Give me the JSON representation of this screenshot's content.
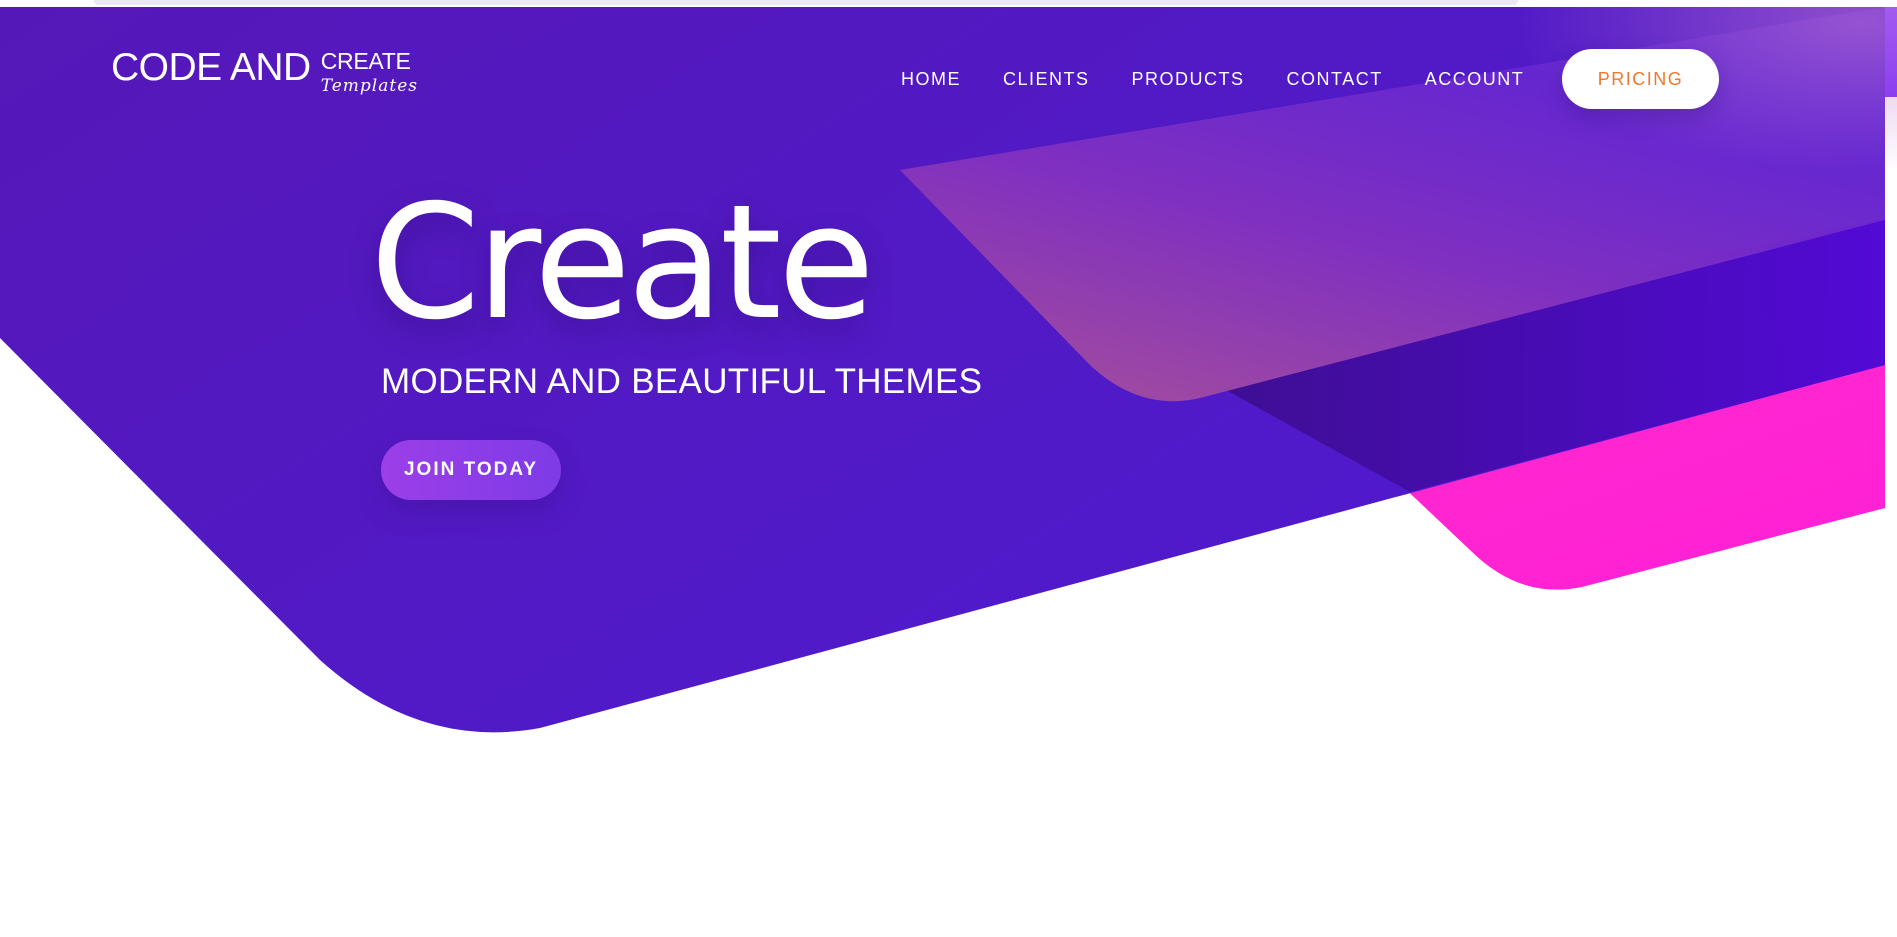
{
  "logo": {
    "main": "CODE AND",
    "create": "CREATE",
    "templates": "Templates"
  },
  "nav": {
    "items": [
      "HOME",
      "CLIENTS",
      "PRODUCTS",
      "CONTACT",
      "ACCOUNT"
    ],
    "pricing": "PRICING"
  },
  "hero": {
    "title": "Create",
    "subtitle": "MODERN AND BEAUTIFUL THEMES",
    "cta": "JOIN TODAY"
  },
  "colors": {
    "hero_purple": "#5118c2",
    "accent_pink": "#ff27cc",
    "accent_orange": "#f0782c",
    "button_purple": "#8c3ff0",
    "white": "#ffffff"
  }
}
